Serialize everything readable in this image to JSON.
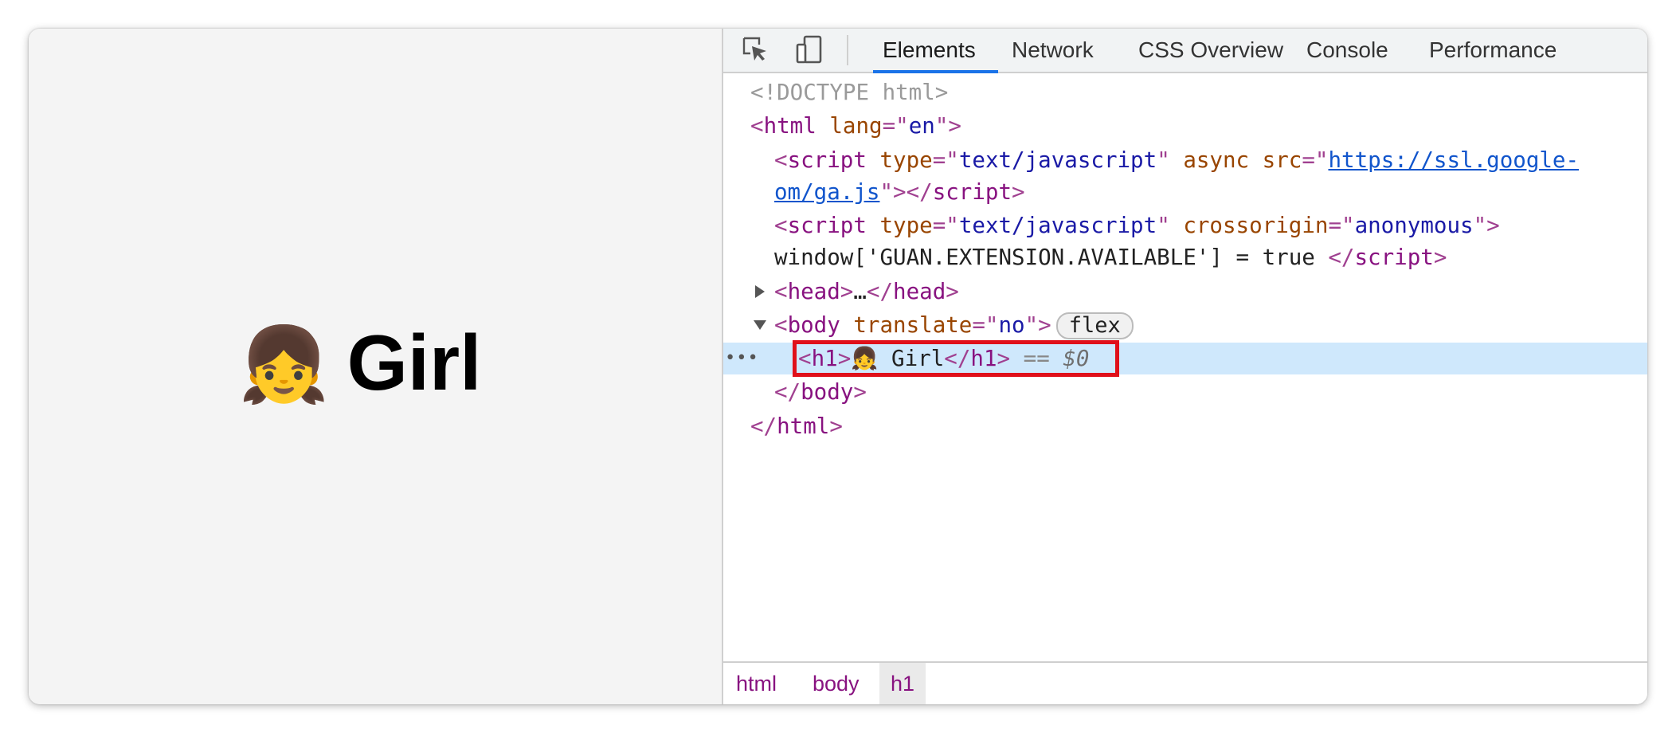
{
  "page": {
    "heading_emoji": "👧",
    "heading_text": "Girl"
  },
  "devtools": {
    "toolbar": {
      "inspect_icon": "inspect-element-icon",
      "device_icon": "device-toolbar-icon"
    },
    "tabs": [
      {
        "label": "Elements",
        "active": true
      },
      {
        "label": "Network",
        "active": false
      },
      {
        "label": "CSS Overview",
        "active": false
      },
      {
        "label": "Console",
        "active": false
      },
      {
        "label": "Performance",
        "active": false
      }
    ],
    "tree": {
      "doctype": "<!DOCTYPE html>",
      "html_open_tag": "html",
      "html_lang_attr": "lang",
      "html_lang_val": "en",
      "script1_tag": "script",
      "script1_type_attr": "type",
      "script1_type_val": "text/javascript",
      "script1_async_attr": "async",
      "script1_src_attr": "src",
      "script1_src_val_line1": "https://ssl.google-",
      "script1_src_val_line2": "om/ga.js",
      "script2_type_val": "text/javascript",
      "script2_cross_attr": "crossorigin",
      "script2_cross_val": "anonymous",
      "script2_text": "window['GUAN.EXTENSION.AVAILABLE'] = true ",
      "head_tag": "head",
      "head_ellipsis": "…",
      "body_tag": "body",
      "body_attr": "translate",
      "body_val": "no",
      "body_badge": "flex",
      "h1_tag": "h1",
      "h1_content": "👧 Girl",
      "h1_eq": " == ",
      "h1_dollar": "$0",
      "row_dots": "•••",
      "html_close_tag": "html"
    },
    "breadcrumbs": [
      {
        "label": "html",
        "active": false
      },
      {
        "label": "body",
        "active": false
      },
      {
        "label": "h1",
        "active": true
      }
    ]
  },
  "colors": {
    "accent_tab_underline": "#1a73e8",
    "selected_row": "#cfe8fc",
    "highlight_box": "#e0101a",
    "tag_color": "#881280",
    "attr_color": "#994500",
    "value_color": "#1a1aa6"
  }
}
